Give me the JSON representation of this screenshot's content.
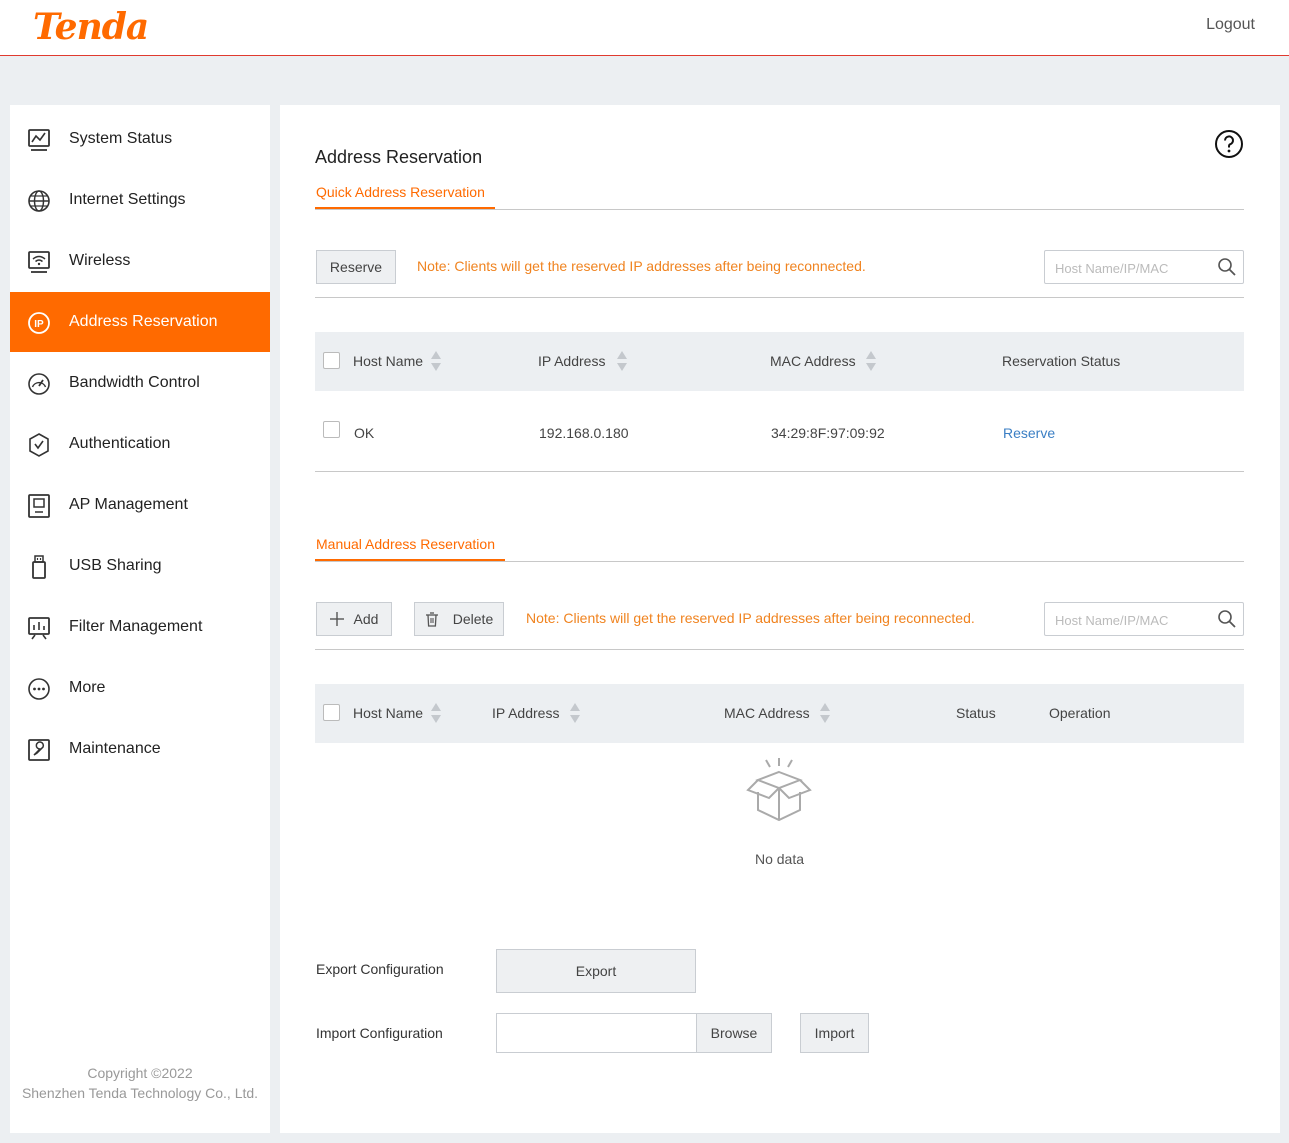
{
  "header": {
    "brand": "Tenda",
    "logout_label": "Logout"
  },
  "sidebar": {
    "items": [
      {
        "label": "System Status",
        "icon": "system-status-icon"
      },
      {
        "label": "Internet Settings",
        "icon": "globe-icon"
      },
      {
        "label": "Wireless",
        "icon": "wifi-icon"
      },
      {
        "label": "Address Reservation",
        "icon": "ip-icon",
        "active": true
      },
      {
        "label": "Bandwidth Control",
        "icon": "gauge-icon"
      },
      {
        "label": "Authentication",
        "icon": "shield-check-icon"
      },
      {
        "label": "AP Management",
        "icon": "ap-icon"
      },
      {
        "label": "USB Sharing",
        "icon": "usb-icon"
      },
      {
        "label": "Filter Management",
        "icon": "filter-chart-icon"
      },
      {
        "label": "More",
        "icon": "more-icon"
      },
      {
        "label": "Maintenance",
        "icon": "wrench-icon"
      }
    ],
    "copyright_line1": "Copyright ©2022",
    "copyright_line2": "Shenzhen Tenda Technology Co., Ltd."
  },
  "main": {
    "title": "Address Reservation",
    "accent_color": "#ff6a00",
    "quick": {
      "tab_label": "Quick Address Reservation",
      "reserve_button": "Reserve",
      "note": "Note: Clients will get the reserved IP addresses after being reconnected.",
      "search_placeholder": "Host Name/IP/MAC",
      "columns": [
        "Host Name",
        "IP Address",
        "MAC Address",
        "Reservation Status"
      ],
      "rows": [
        {
          "host": "OK",
          "ip": "192.168.0.180",
          "mac": "34:29:8F:97:09:92",
          "action": "Reserve"
        }
      ]
    },
    "manual": {
      "tab_label": "Manual Address Reservation",
      "add_button": "Add",
      "delete_button": "Delete",
      "note": "Note: Clients will get the reserved IP addresses after being reconnected.",
      "search_placeholder": "Host Name/IP/MAC",
      "columns": [
        "Host Name",
        "IP Address",
        "MAC Address",
        "Status",
        "Operation"
      ],
      "empty_text": "No data"
    },
    "config": {
      "export_label": "Export Configuration",
      "export_button": "Export",
      "import_label": "Import Configuration",
      "browse_button": "Browse",
      "import_button": "Import"
    }
  }
}
